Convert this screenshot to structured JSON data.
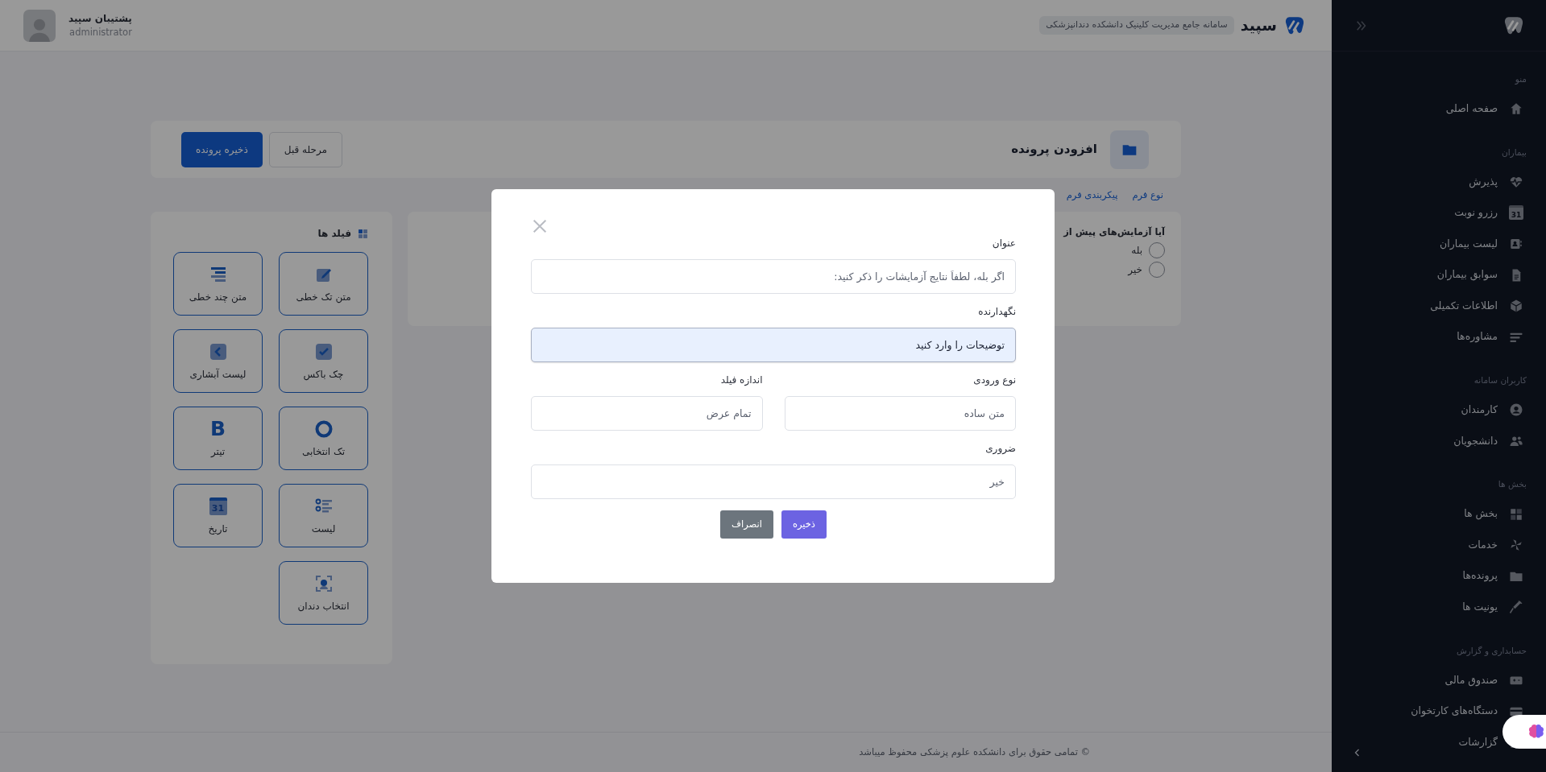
{
  "app_header": {
    "brand": "سپید",
    "subtitle": "سامانه جامع مدیریت کلینیک دانشکده دندانپزشکی",
    "user_name": "پشتیبان سپید",
    "user_role": "administrator"
  },
  "sidebar": {
    "sections": [
      {
        "title": "منو",
        "items": [
          {
            "label": "صفحه اصلی"
          }
        ]
      },
      {
        "title": "بیماران",
        "items": [
          {
            "label": "پذیرش"
          },
          {
            "label": "رزرو نوبت",
            "glyph": "31"
          },
          {
            "label": "لیست بیماران"
          },
          {
            "label": "سوابق بیماران"
          },
          {
            "label": "اطلاعات تکمیلی"
          },
          {
            "label": "مشاوره‌ها"
          }
        ]
      },
      {
        "title": "کاربران سامانه",
        "items": [
          {
            "label": "کارمندان"
          },
          {
            "label": "دانشجویان"
          }
        ]
      },
      {
        "title": "بخش ها",
        "items": [
          {
            "label": "بخش ها"
          },
          {
            "label": "خدمات"
          },
          {
            "label": "پرونده‌ها"
          },
          {
            "label": "یونیت ها"
          }
        ]
      },
      {
        "title": "حسابداری و گزارش",
        "items": [
          {
            "label": "صندوق مالی"
          },
          {
            "label": "دستگاه‌های کارتخوان"
          },
          {
            "label": "گزارشات"
          }
        ]
      }
    ]
  },
  "page_header": {
    "title": "افزودن پرونده",
    "buttons": [
      {
        "label": "مرحله قبل",
        "kind": "outline"
      },
      {
        "label": "ذخیره پرونده",
        "kind": "primary"
      }
    ]
  },
  "tabs": [
    {
      "label": "نوع فرم"
    },
    {
      "label": "پیکربندی فرم"
    }
  ],
  "form_preview": {
    "question": "آیا آزمایش‌های پیش از",
    "options": [
      {
        "label": "بله",
        "selected": false
      },
      {
        "label": "خیر",
        "selected": false
      }
    ]
  },
  "fields_panel": {
    "title": "فیلد ها",
    "items": [
      {
        "label": "متن تک خطی"
      },
      {
        "label": "متن چند خطی"
      },
      {
        "label": "چک باکس"
      },
      {
        "label": "لیست آبشاری"
      },
      {
        "label": "تک انتخابی"
      },
      {
        "label": "تیتر"
      },
      {
        "label": "لیست"
      },
      {
        "label": "تاریخ"
      },
      {
        "label": "انتخاب دندان"
      }
    ],
    "icon_glyphs": [
      "B",
      "31"
    ]
  },
  "modal": {
    "rows": [
      {
        "fields": [
          {
            "label": "عنوان",
            "value": "اگر بله، لطفاً نتایج آزمایشات را ذکر کنید:",
            "focused": false
          }
        ]
      },
      {
        "fields": [
          {
            "label": "نگهدارنده",
            "value": "توضیحات را وارد کنید",
            "focused": true
          }
        ]
      },
      {
        "fields": [
          {
            "label": "نوع ورودی",
            "value": "متن ساده",
            "focused": false
          },
          {
            "label": "اندازه فیلد",
            "value": "تمام عرض",
            "focused": false
          }
        ]
      },
      {
        "fields": [
          {
            "label": "ضروری",
            "value": "خیر",
            "focused": false
          }
        ]
      }
    ],
    "buttons": [
      {
        "label": "ذخیره",
        "kind": "primary"
      },
      {
        "label": "انصراف",
        "kind": "secondary"
      }
    ]
  },
  "footer": {
    "text": "© تمامی حقوق برای دانشکده علوم پزشکی محفوظ میباشد"
  }
}
